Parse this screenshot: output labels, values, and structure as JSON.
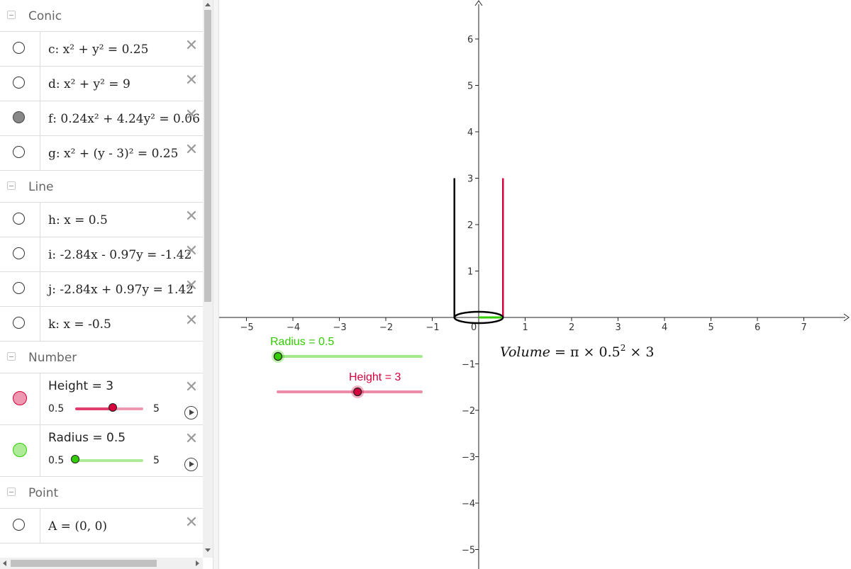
{
  "algebra": {
    "groups": {
      "conic": "Conic",
      "line": "Line",
      "number": "Number",
      "point": "Point"
    },
    "conics": [
      {
        "text": "c: x² + y² = 0.25",
        "filled": false
      },
      {
        "text": "d: x² + y² = 9",
        "filled": false
      },
      {
        "text": "f: 0.24x² + 4.24y² = 0.06",
        "filled": true
      },
      {
        "text": "g: x² + (y - 3)² = 0.25",
        "filled": false
      }
    ],
    "lines": [
      {
        "text": "h: x = 0.5"
      },
      {
        "text": "i: -2.84x - 0.97y = -1.42"
      },
      {
        "text": "j: -2.84x + 0.97y = 1.42"
      },
      {
        "text": "k: x = -0.5"
      }
    ],
    "numbers": [
      {
        "text": "Height = 3",
        "min": "0.5",
        "max": "5",
        "value": 3,
        "min_val": 0.5,
        "max_val": 5,
        "color": "#d5003c"
      },
      {
        "text": "Radius = 0.5",
        "min": "0.5",
        "max": "5",
        "value": 0.5,
        "min_val": 0.5,
        "max_val": 5,
        "color": "#33cc00"
      }
    ],
    "points": [
      {
        "text": "A = (0, 0)"
      }
    ]
  },
  "graphics": {
    "x_ticks": [
      "−5",
      "−4",
      "−3",
      "−2",
      "−1",
      "0",
      "1",
      "2",
      "3",
      "4",
      "5",
      "6",
      "7"
    ],
    "x_values": [
      -5,
      -4,
      -3,
      -2,
      -1,
      0,
      1,
      2,
      3,
      4,
      5,
      6,
      7
    ],
    "y_ticks": [
      "6",
      "5",
      "4",
      "3",
      "2",
      "1",
      "−1",
      "−2",
      "−3",
      "−4",
      "−5"
    ],
    "y_values": [
      6,
      5,
      4,
      3,
      2,
      1,
      -1,
      -2,
      -3,
      -4,
      -5
    ],
    "radius_slider": {
      "label": "Radius = 0.5",
      "value": 0.5,
      "min": 0.5,
      "max": 5,
      "color": "#33cc00"
    },
    "height_slider": {
      "label": "Height = 3",
      "value": 3,
      "min": 0.5,
      "max": 5,
      "color": "#d5003c"
    },
    "formula": {
      "lhs": "Volume",
      "eq": " = π × 0.5",
      "exp": "2",
      "tail": " × 3"
    },
    "colors": {
      "axis": "#222222",
      "height_line": "#d5003c",
      "radius_line": "#33cc00",
      "cylinder": "#000000"
    }
  }
}
